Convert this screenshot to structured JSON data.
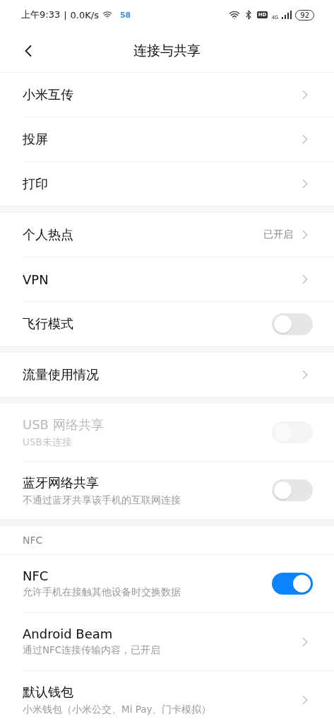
{
  "status_bar": {
    "time": "上午9:33",
    "separator": "|",
    "speed": "0.0K/s",
    "app_badge": "58",
    "hd": "HD",
    "network": "4G",
    "battery": "92"
  },
  "header": {
    "title": "连接与共享"
  },
  "groups": [
    {
      "items": [
        {
          "kind": "link",
          "title": "小米互传",
          "disabled": false
        },
        {
          "kind": "link",
          "title": "投屏",
          "disabled": false
        },
        {
          "kind": "link",
          "title": "打印",
          "disabled": false
        }
      ]
    },
    {
      "items": [
        {
          "kind": "link",
          "title": "个人热点",
          "value": "已开启",
          "disabled": false
        },
        {
          "kind": "link",
          "title": "VPN",
          "disabled": false
        },
        {
          "kind": "toggle",
          "title": "飞行模式",
          "on": false,
          "disabled": false
        }
      ]
    },
    {
      "items": [
        {
          "kind": "link",
          "title": "流量使用情况",
          "disabled": false
        }
      ]
    },
    {
      "items": [
        {
          "kind": "toggle",
          "title": "USB 网络共享",
          "subtitle": "USB未连接",
          "on": false,
          "disabled": true
        },
        {
          "kind": "toggle",
          "title": "蓝牙网络共享",
          "subtitle": "不通过蓝牙共享该手机的互联网连接",
          "on": false,
          "disabled": false
        }
      ]
    },
    {
      "header": "NFC",
      "items": [
        {
          "kind": "toggle",
          "title": "NFC",
          "subtitle": "允许手机在接触其他设备时交换数据",
          "on": true,
          "disabled": false
        },
        {
          "kind": "link",
          "title": "Android Beam",
          "subtitle": "通过NFC连接传输内容，已开启",
          "disabled": false
        },
        {
          "kind": "link",
          "title": "默认钱包",
          "subtitle": "小米钱包（小米公交、Mi Pay、门卡模拟）",
          "disabled": false
        }
      ]
    }
  ]
}
